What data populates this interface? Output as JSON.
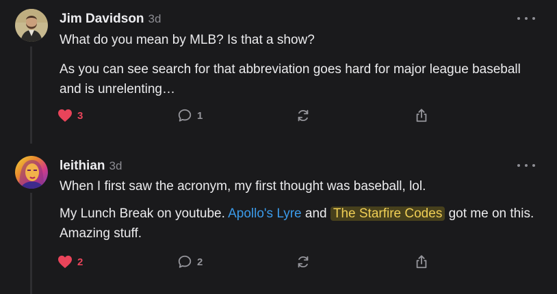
{
  "colors": {
    "background": "#1a1a1c",
    "heart": "#e9445a",
    "link": "#3b9bea",
    "highlight_text": "#f0cf55",
    "highlight_bg": "#47401c",
    "icon": "#96969c"
  },
  "posts": [
    {
      "author": "Jim Davidson",
      "time": "3d",
      "paragraphs": [
        "What do you mean by MLB? Is that a show?",
        "As you can see search for that abbreviation goes hard for major league baseball and is unrelenting…"
      ],
      "likes": "3",
      "replies": "1",
      "icons": {
        "like": "heart-icon",
        "reply": "speech-bubble-icon",
        "repost": "repost-icon",
        "share": "share-icon",
        "more": "more-dots-icon"
      }
    },
    {
      "author": "leithian",
      "time": "3d",
      "paragraphs": [
        "When I first saw the acronym, my first thought was baseball, lol."
      ],
      "rich": {
        "before": "My Lunch Break on youtube. ",
        "link1": "Apollo's Lyre",
        "middle": " and ",
        "link2": "The Starfire Codes",
        "after": " got me on this. Amazing stuff."
      },
      "likes": "2",
      "replies": "2",
      "icons": {
        "like": "heart-icon",
        "reply": "speech-bubble-icon",
        "repost": "repost-icon",
        "share": "share-icon",
        "more": "more-dots-icon"
      }
    }
  ]
}
